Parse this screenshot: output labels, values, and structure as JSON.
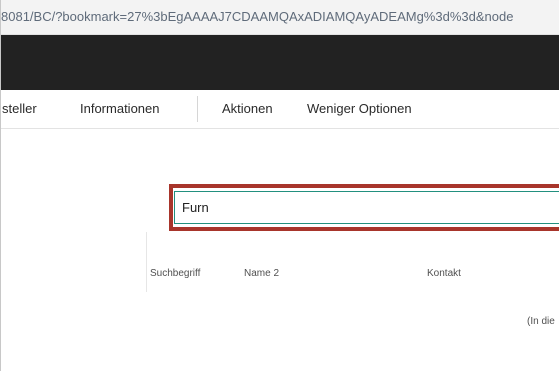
{
  "browser": {
    "url": "8081/BC/?bookmark=27%3bEgAAAAJ7CDAAMQAxADIAMQAyADEAMg%3d%3d&node"
  },
  "actionbar": {
    "items": [
      {
        "label": "steller"
      },
      {
        "label": "Informationen"
      },
      {
        "label": "Aktionen"
      },
      {
        "label": "Weniger Optionen"
      }
    ]
  },
  "search": {
    "value": "Furn",
    "highlight_color": "#a8352b",
    "focus_border_color": "#22907f"
  },
  "table": {
    "columns": [
      "Suchbegriff",
      "Name 2",
      "Kontakt"
    ],
    "empty_text": "(In die"
  }
}
